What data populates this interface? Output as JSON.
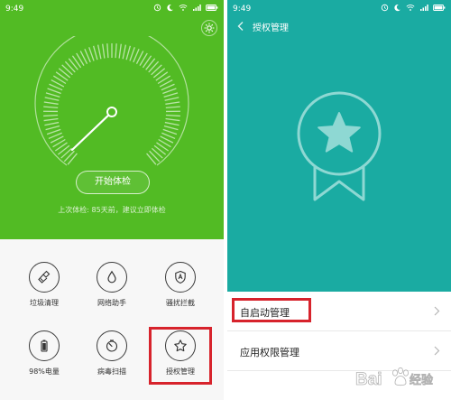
{
  "left_screen": {
    "status_time": "9:49",
    "start_button_label": "开始体检",
    "last_check_text": "上次体检: 85天前，建议立即体检",
    "tools": [
      {
        "label": "垃圾清理",
        "icon": "broom-icon"
      },
      {
        "label": "网络助手",
        "icon": "water-drop-icon"
      },
      {
        "label": "骚扰拦截",
        "icon": "shield-icon"
      },
      {
        "label": "98%电量",
        "icon": "battery-icon"
      },
      {
        "label": "病毒扫描",
        "icon": "scan-gauge-icon"
      },
      {
        "label": "授权管理",
        "icon": "star-icon"
      }
    ],
    "colors": {
      "background": "#52bb24",
      "highlight": "#d7232c"
    }
  },
  "right_screen": {
    "status_time": "9:49",
    "title": "授权管理",
    "list": [
      {
        "label": "自启动管理"
      },
      {
        "label": "应用权限管理"
      }
    ],
    "colors": {
      "background": "#1aaba2",
      "badge": "#8ed8d3"
    }
  },
  "watermark": {
    "text": "Bai 经验"
  }
}
